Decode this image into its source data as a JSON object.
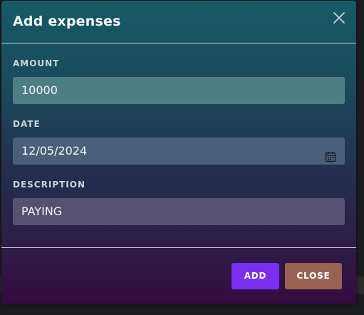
{
  "modal": {
    "title": "Add expenses",
    "close_icon": "close-icon"
  },
  "form": {
    "amount": {
      "label": "AMOUNT",
      "value": "10000"
    },
    "date": {
      "label": "DATE",
      "value": "12/05/2024",
      "icon": "calendar-icon"
    },
    "description": {
      "label": "DESCRIPTION",
      "value": "PAYING"
    }
  },
  "footer": {
    "add_label": "ADD",
    "close_label": "CLOSE"
  },
  "colors": {
    "add_button": "#7a2ff0",
    "close_button": "#9a6252"
  }
}
